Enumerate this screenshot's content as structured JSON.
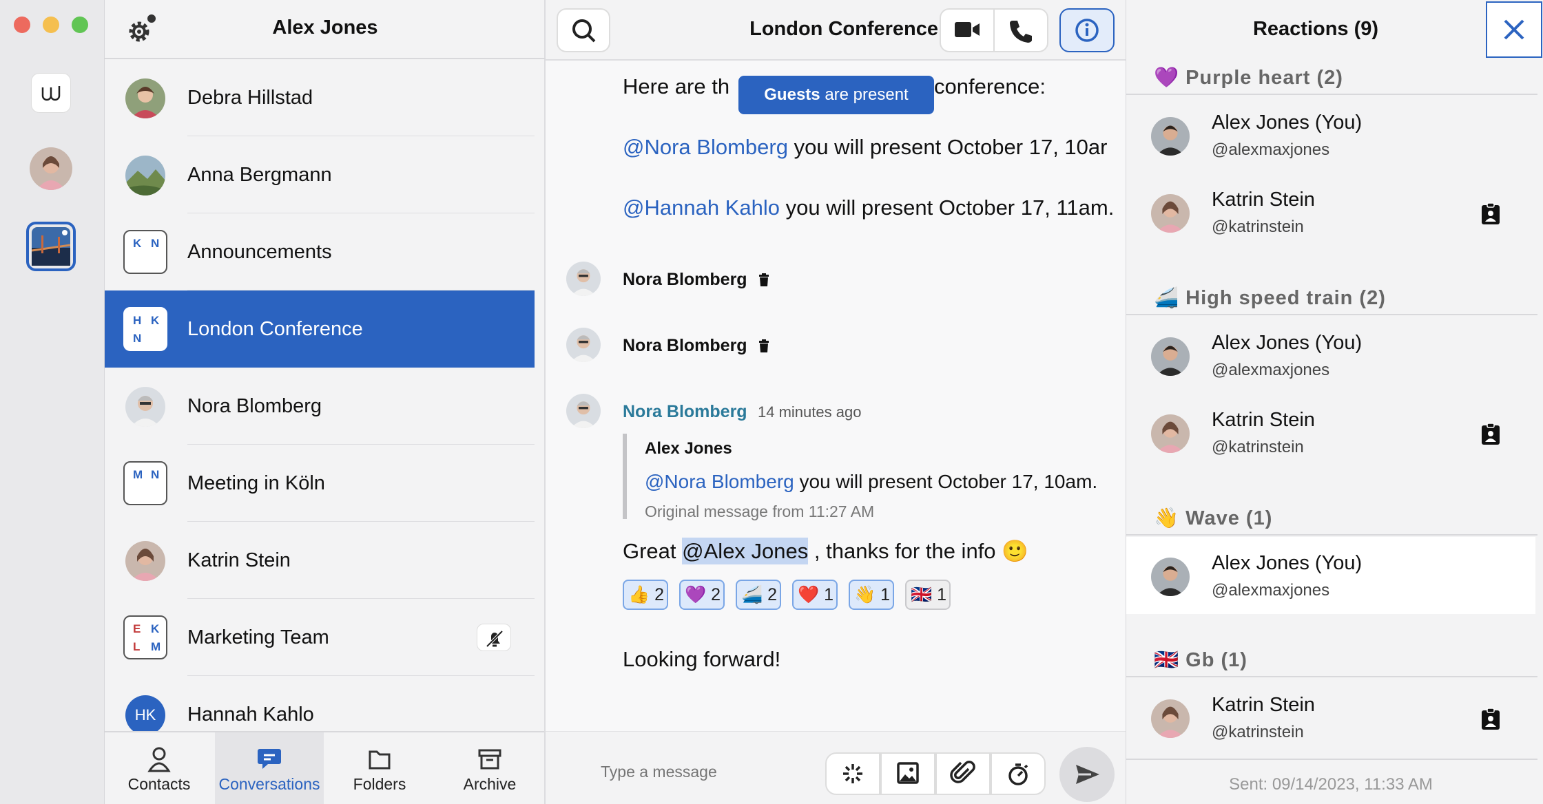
{
  "sidebar": {
    "user": "Alex Jones"
  },
  "conversations": [
    {
      "name": "Debra Hillstad",
      "type": "person"
    },
    {
      "name": "Anna Bergmann",
      "type": "person"
    },
    {
      "name": "Announcements",
      "type": "group",
      "initials": [
        "K",
        "N"
      ]
    },
    {
      "name": "London Conference",
      "type": "group",
      "initials": [
        "H",
        "K",
        "N"
      ],
      "selected": true
    },
    {
      "name": "Nora Blomberg",
      "type": "person"
    },
    {
      "name": "Meeting in Köln",
      "type": "group",
      "initials": [
        "M",
        "N"
      ]
    },
    {
      "name": "Katrin Stein",
      "type": "person"
    },
    {
      "name": "Marketing Team",
      "type": "group",
      "initials": [
        "E",
        "K",
        "L",
        "M"
      ],
      "muted": true
    },
    {
      "name": "Hannah Kahlo",
      "type": "person",
      "initials": "HK"
    }
  ],
  "tabs": [
    {
      "label": "Contacts",
      "icon": "person-icon"
    },
    {
      "label": "Conversations",
      "icon": "chat-icon",
      "active": true
    },
    {
      "label": "Folders",
      "icon": "folder-icon"
    },
    {
      "label": "Archive",
      "icon": "archive-icon"
    }
  ],
  "conversation": {
    "title": "London Conference",
    "guest_banner": {
      "bold": "Guests",
      "rest": "are present"
    },
    "intro_start": "Here are th",
    "intro_end": "conference:",
    "line1": {
      "mention": "@Nora Blomberg",
      "text": "you will present October 17, 10ar"
    },
    "line2": {
      "mention": "@Hannah Kahlo",
      "text": "you will present October 17, 11am."
    },
    "deleted1": {
      "sender": "Nora Blomberg"
    },
    "deleted2": {
      "sender": "Nora Blomberg"
    },
    "reply": {
      "sender": "Nora Blomberg",
      "time": "14 minutes ago",
      "quote_author": "Alex Jones",
      "quote_mention": "@Nora Blomberg",
      "quote_text": "you will present October 17, 10am.",
      "quote_meta": "Original message from 11:27 AM",
      "body_start": "Great",
      "body_mention": "@Alex Jones",
      "body_end": ", thanks for the info 🙂"
    },
    "reactions": [
      {
        "emoji": "👍",
        "count": "2"
      },
      {
        "emoji": "💜",
        "count": "2"
      },
      {
        "emoji": "🚄",
        "count": "2"
      },
      {
        "emoji": "❤️",
        "count": "1"
      },
      {
        "emoji": "👋",
        "count": "1"
      },
      {
        "emoji": "🇬🇧",
        "count": "1"
      }
    ],
    "last_message": "Looking forward!",
    "composer_placeholder": "Type a message"
  },
  "panel": {
    "title": "Reactions (9)",
    "groups": [
      {
        "emoji": "💜",
        "label": "Purple heart  (2)",
        "people": [
          {
            "name": "Alex Jones (You)",
            "handle": "@alexmaxjones"
          },
          {
            "name": "Katrin Stein",
            "handle": "@katrinstein",
            "badge": true
          }
        ]
      },
      {
        "emoji": "🚄",
        "label": "High speed train  (2)",
        "people": [
          {
            "name": "Alex Jones (You)",
            "handle": "@alexmaxjones"
          },
          {
            "name": "Katrin Stein",
            "handle": "@katrinstein",
            "badge": true
          }
        ]
      },
      {
        "emoji": "👋",
        "label": "Wave  (1)",
        "people": [
          {
            "name": "Alex Jones (You)",
            "handle": "@alexmaxjones",
            "highlight": true
          }
        ]
      },
      {
        "emoji": "🇬🇧",
        "label": "Gb  (1)",
        "people": [
          {
            "name": "Katrin Stein",
            "handle": "@katrinstein",
            "badge": true
          }
        ]
      }
    ],
    "sent": "Sent: 09/14/2023, 11:33 AM"
  },
  "colors": {
    "accent": "#2b63c0",
    "selected_row": "#2b63c0"
  }
}
